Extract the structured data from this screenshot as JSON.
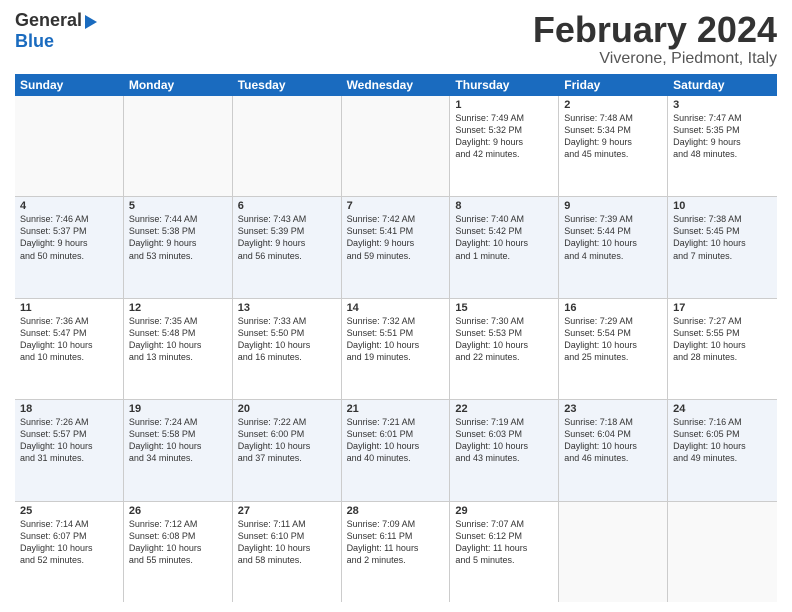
{
  "logo": {
    "general": "General",
    "blue": "Blue"
  },
  "title": "February 2024",
  "subtitle": "Viverone, Piedmont, Italy",
  "weekdays": [
    "Sunday",
    "Monday",
    "Tuesday",
    "Wednesday",
    "Thursday",
    "Friday",
    "Saturday"
  ],
  "rows": [
    {
      "alt": false,
      "cells": [
        {
          "day": "",
          "info": ""
        },
        {
          "day": "",
          "info": ""
        },
        {
          "day": "",
          "info": ""
        },
        {
          "day": "",
          "info": ""
        },
        {
          "day": "1",
          "info": "Sunrise: 7:49 AM\nSunset: 5:32 PM\nDaylight: 9 hours\nand 42 minutes."
        },
        {
          "day": "2",
          "info": "Sunrise: 7:48 AM\nSunset: 5:34 PM\nDaylight: 9 hours\nand 45 minutes."
        },
        {
          "day": "3",
          "info": "Sunrise: 7:47 AM\nSunset: 5:35 PM\nDaylight: 9 hours\nand 48 minutes."
        }
      ]
    },
    {
      "alt": true,
      "cells": [
        {
          "day": "4",
          "info": "Sunrise: 7:46 AM\nSunset: 5:37 PM\nDaylight: 9 hours\nand 50 minutes."
        },
        {
          "day": "5",
          "info": "Sunrise: 7:44 AM\nSunset: 5:38 PM\nDaylight: 9 hours\nand 53 minutes."
        },
        {
          "day": "6",
          "info": "Sunrise: 7:43 AM\nSunset: 5:39 PM\nDaylight: 9 hours\nand 56 minutes."
        },
        {
          "day": "7",
          "info": "Sunrise: 7:42 AM\nSunset: 5:41 PM\nDaylight: 9 hours\nand 59 minutes."
        },
        {
          "day": "8",
          "info": "Sunrise: 7:40 AM\nSunset: 5:42 PM\nDaylight: 10 hours\nand 1 minute."
        },
        {
          "day": "9",
          "info": "Sunrise: 7:39 AM\nSunset: 5:44 PM\nDaylight: 10 hours\nand 4 minutes."
        },
        {
          "day": "10",
          "info": "Sunrise: 7:38 AM\nSunset: 5:45 PM\nDaylight: 10 hours\nand 7 minutes."
        }
      ]
    },
    {
      "alt": false,
      "cells": [
        {
          "day": "11",
          "info": "Sunrise: 7:36 AM\nSunset: 5:47 PM\nDaylight: 10 hours\nand 10 minutes."
        },
        {
          "day": "12",
          "info": "Sunrise: 7:35 AM\nSunset: 5:48 PM\nDaylight: 10 hours\nand 13 minutes."
        },
        {
          "day": "13",
          "info": "Sunrise: 7:33 AM\nSunset: 5:50 PM\nDaylight: 10 hours\nand 16 minutes."
        },
        {
          "day": "14",
          "info": "Sunrise: 7:32 AM\nSunset: 5:51 PM\nDaylight: 10 hours\nand 19 minutes."
        },
        {
          "day": "15",
          "info": "Sunrise: 7:30 AM\nSunset: 5:53 PM\nDaylight: 10 hours\nand 22 minutes."
        },
        {
          "day": "16",
          "info": "Sunrise: 7:29 AM\nSunset: 5:54 PM\nDaylight: 10 hours\nand 25 minutes."
        },
        {
          "day": "17",
          "info": "Sunrise: 7:27 AM\nSunset: 5:55 PM\nDaylight: 10 hours\nand 28 minutes."
        }
      ]
    },
    {
      "alt": true,
      "cells": [
        {
          "day": "18",
          "info": "Sunrise: 7:26 AM\nSunset: 5:57 PM\nDaylight: 10 hours\nand 31 minutes."
        },
        {
          "day": "19",
          "info": "Sunrise: 7:24 AM\nSunset: 5:58 PM\nDaylight: 10 hours\nand 34 minutes."
        },
        {
          "day": "20",
          "info": "Sunrise: 7:22 AM\nSunset: 6:00 PM\nDaylight: 10 hours\nand 37 minutes."
        },
        {
          "day": "21",
          "info": "Sunrise: 7:21 AM\nSunset: 6:01 PM\nDaylight: 10 hours\nand 40 minutes."
        },
        {
          "day": "22",
          "info": "Sunrise: 7:19 AM\nSunset: 6:03 PM\nDaylight: 10 hours\nand 43 minutes."
        },
        {
          "day": "23",
          "info": "Sunrise: 7:18 AM\nSunset: 6:04 PM\nDaylight: 10 hours\nand 46 minutes."
        },
        {
          "day": "24",
          "info": "Sunrise: 7:16 AM\nSunset: 6:05 PM\nDaylight: 10 hours\nand 49 minutes."
        }
      ]
    },
    {
      "alt": false,
      "cells": [
        {
          "day": "25",
          "info": "Sunrise: 7:14 AM\nSunset: 6:07 PM\nDaylight: 10 hours\nand 52 minutes."
        },
        {
          "day": "26",
          "info": "Sunrise: 7:12 AM\nSunset: 6:08 PM\nDaylight: 10 hours\nand 55 minutes."
        },
        {
          "day": "27",
          "info": "Sunrise: 7:11 AM\nSunset: 6:10 PM\nDaylight: 10 hours\nand 58 minutes."
        },
        {
          "day": "28",
          "info": "Sunrise: 7:09 AM\nSunset: 6:11 PM\nDaylight: 11 hours\nand 2 minutes."
        },
        {
          "day": "29",
          "info": "Sunrise: 7:07 AM\nSunset: 6:12 PM\nDaylight: 11 hours\nand 5 minutes."
        },
        {
          "day": "",
          "info": ""
        },
        {
          "day": "",
          "info": ""
        }
      ]
    }
  ]
}
